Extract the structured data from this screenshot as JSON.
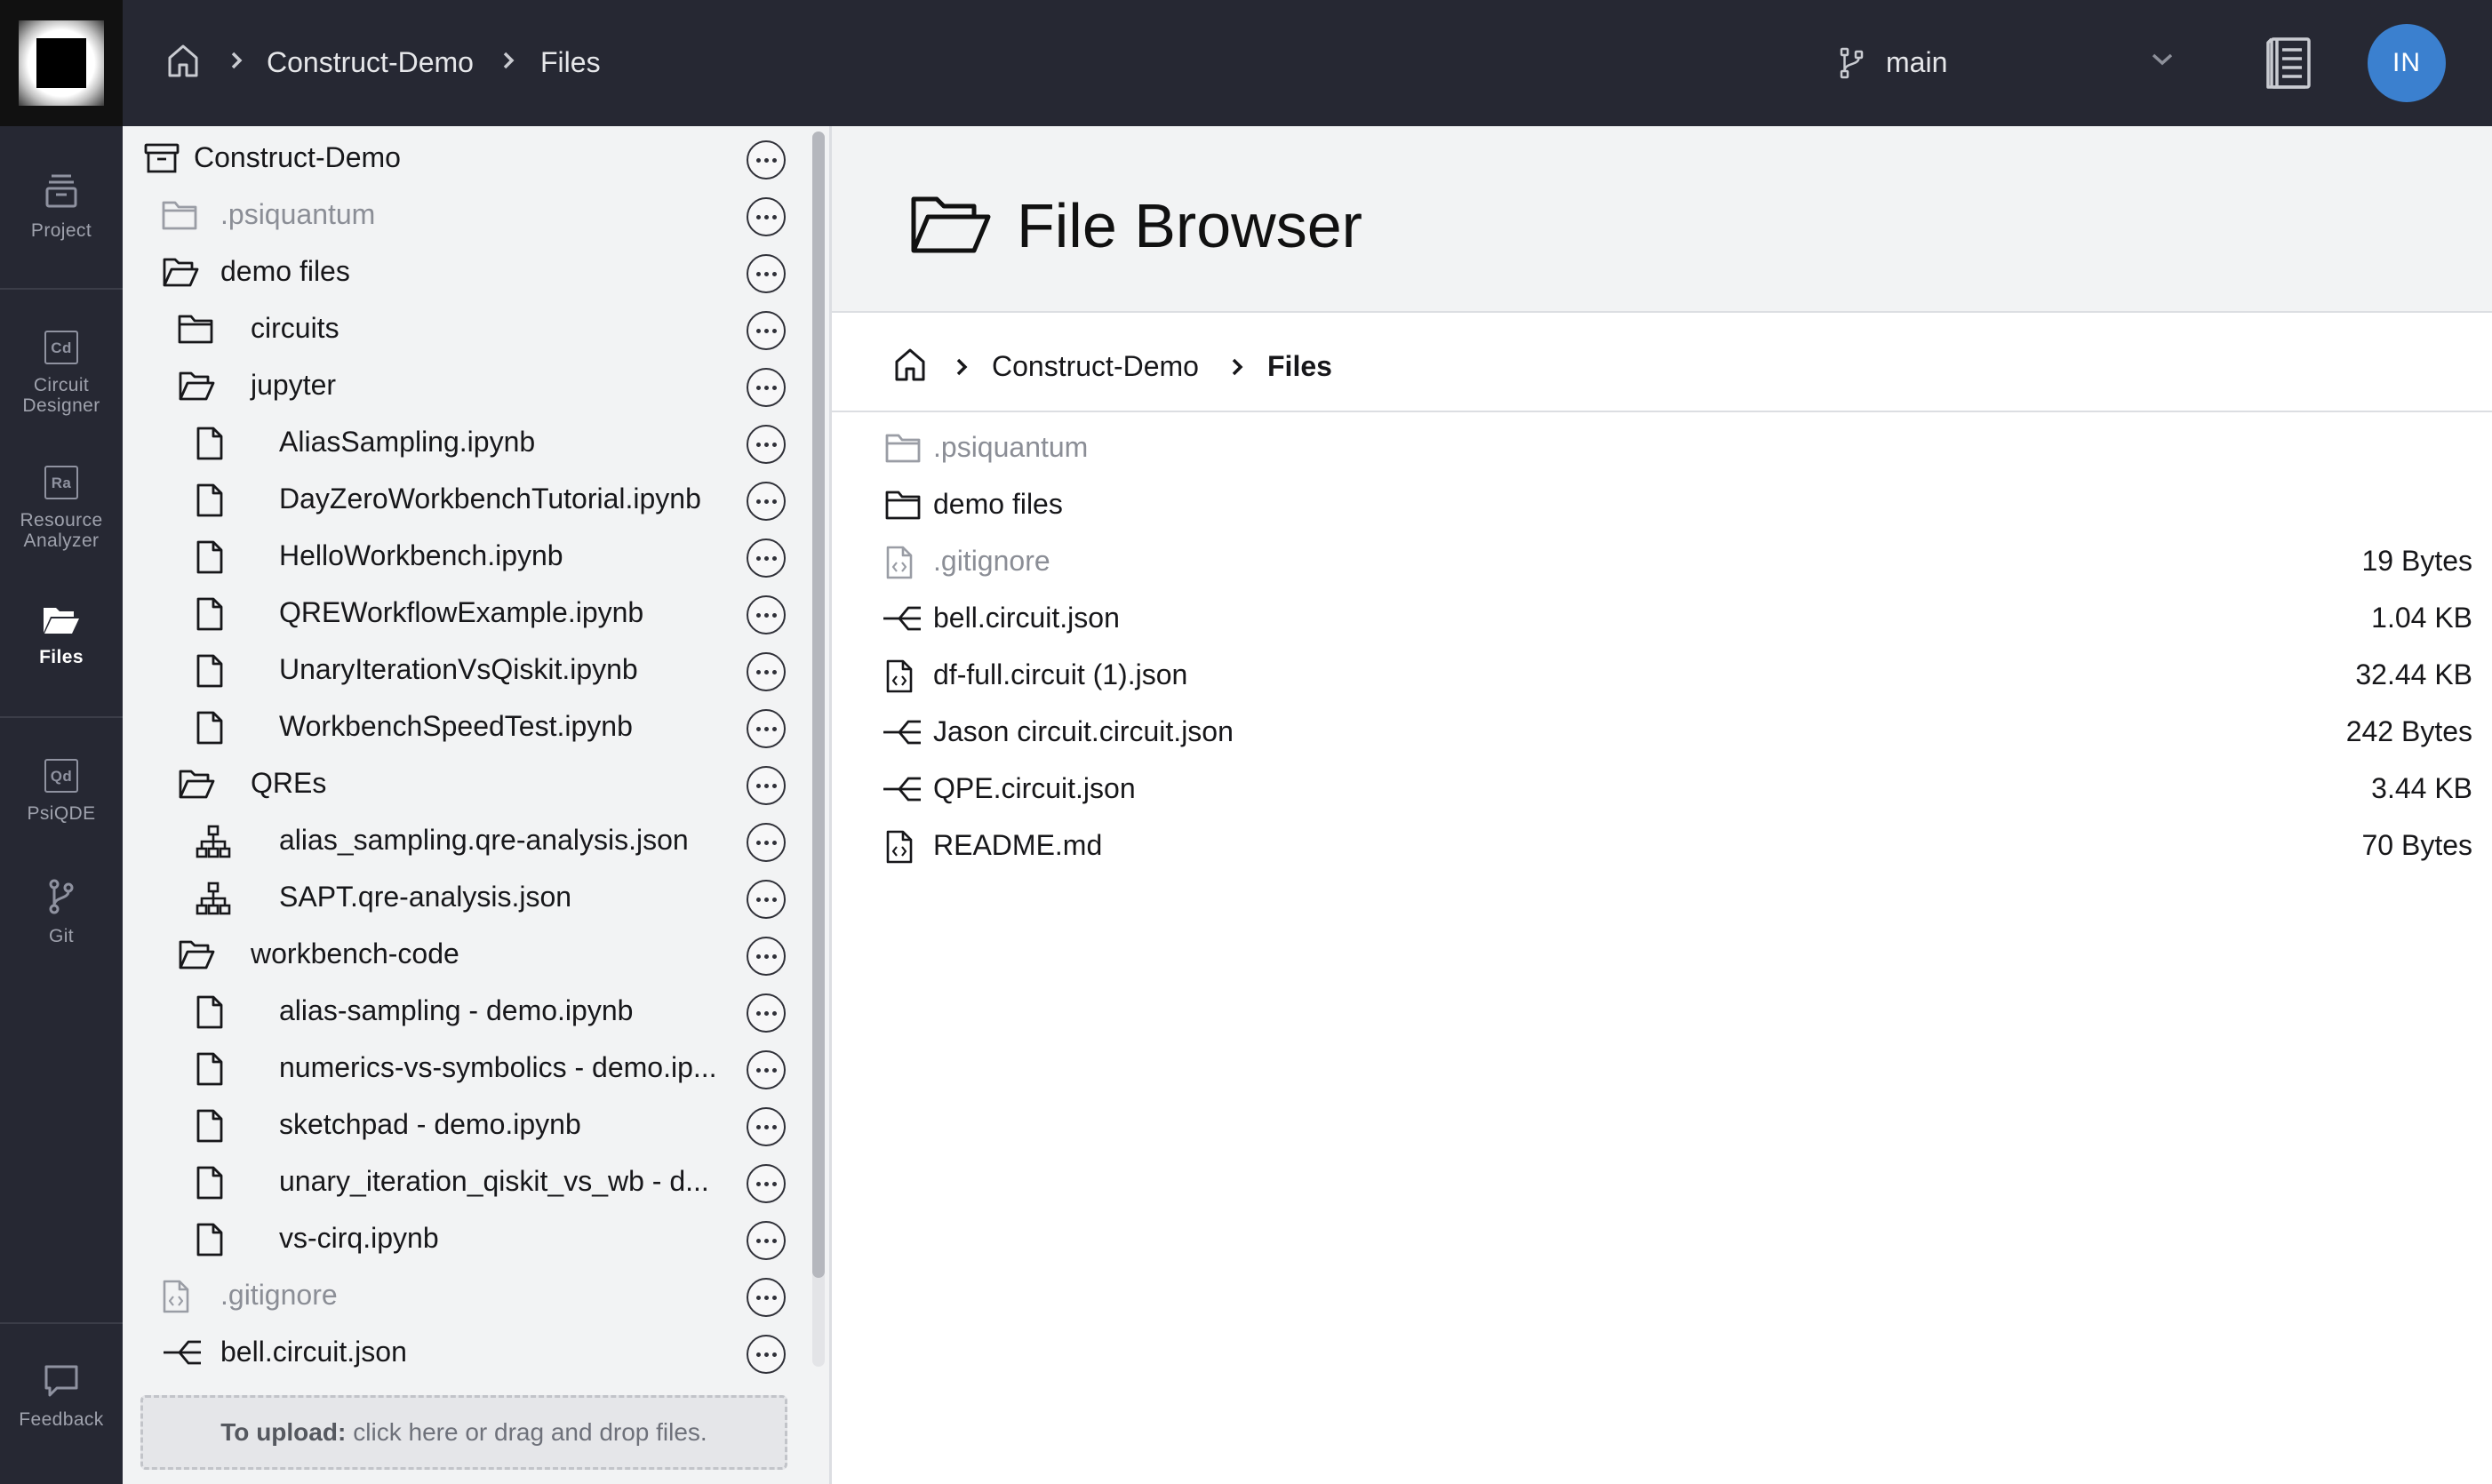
{
  "header": {
    "breadcrumb": [
      "Construct-Demo",
      "Files"
    ],
    "branch": "main",
    "avatar_initials": "IN"
  },
  "rail": {
    "items": [
      {
        "label": "Project",
        "icon": "project-icon"
      },
      {
        "label": "Circuit\nDesigner",
        "icon": "circuit-designer-icon",
        "abbr": "Cd"
      },
      {
        "label": "Resource\nAnalyzer",
        "icon": "resource-analyzer-icon",
        "abbr": "Ra"
      },
      {
        "label": "Files",
        "icon": "folder-open-icon",
        "active": true
      },
      {
        "label": "PsiQDE",
        "icon": "psiqde-icon",
        "abbr": "Qd"
      },
      {
        "label": "Git",
        "icon": "git-branch-icon"
      },
      {
        "label": "Feedback",
        "icon": "feedback-icon"
      }
    ]
  },
  "tree": {
    "items": [
      {
        "label": "Construct-Demo",
        "icon": "repository-icon",
        "depth": 0
      },
      {
        "label": ".psiquantum",
        "icon": "folder-icon",
        "depth": 1,
        "muted": true
      },
      {
        "label": "demo files",
        "icon": "folder-open-icon",
        "depth": 1
      },
      {
        "label": "circuits",
        "icon": "folder-icon",
        "depth": 2
      },
      {
        "label": "jupyter",
        "icon": "folder-open-icon",
        "depth": 2
      },
      {
        "label": "AliasSampling.ipynb",
        "icon": "file-icon",
        "depth": 3
      },
      {
        "label": "DayZeroWorkbenchTutorial.ipynb",
        "icon": "file-icon",
        "depth": 3
      },
      {
        "label": "HelloWorkbench.ipynb",
        "icon": "file-icon",
        "depth": 3
      },
      {
        "label": "QREWorkflowExample.ipynb",
        "icon": "file-icon",
        "depth": 3
      },
      {
        "label": "UnaryIterationVsQiskit.ipynb",
        "icon": "file-icon",
        "depth": 3
      },
      {
        "label": "WorkbenchSpeedTest.ipynb",
        "icon": "file-icon",
        "depth": 3
      },
      {
        "label": "QREs",
        "icon": "folder-open-icon",
        "depth": 2
      },
      {
        "label": "alias_sampling.qre-analysis.json",
        "icon": "hierarchy-icon",
        "depth": 3
      },
      {
        "label": "SAPT.qre-analysis.json",
        "icon": "hierarchy-icon",
        "depth": 3
      },
      {
        "label": "workbench-code",
        "icon": "folder-open-icon",
        "depth": 2
      },
      {
        "label": "alias-sampling - demo.ipynb",
        "icon": "file-icon",
        "depth": 3
      },
      {
        "label": "numerics-vs-symbolics - demo.ip...",
        "icon": "file-icon",
        "depth": 3
      },
      {
        "label": "sketchpad - demo.ipynb",
        "icon": "file-icon",
        "depth": 3
      },
      {
        "label": "unary_iteration_qiskit_vs_wb - d...",
        "icon": "file-icon",
        "depth": 3
      },
      {
        "label": "vs-cirq.ipynb",
        "icon": "file-icon",
        "depth": 3
      },
      {
        "label": ".gitignore",
        "icon": "code-file-icon",
        "depth": 1,
        "muted": true
      },
      {
        "label": "bell.circuit.json",
        "icon": "circuit-icon",
        "depth": 1
      }
    ],
    "upload_bold": "To upload:",
    "upload_text": "click here or drag and drop files."
  },
  "main": {
    "title": "File Browser",
    "breadcrumb": [
      "Construct-Demo",
      "Files"
    ],
    "files": [
      {
        "name": ".psiquantum",
        "icon": "folder-icon",
        "size": "",
        "muted": true
      },
      {
        "name": "demo files",
        "icon": "folder-icon",
        "size": ""
      },
      {
        "name": ".gitignore",
        "icon": "code-file-icon",
        "size": "19 Bytes",
        "muted": true
      },
      {
        "name": "bell.circuit.json",
        "icon": "circuit-icon",
        "size": "1.04 KB"
      },
      {
        "name": "df-full.circuit (1).json",
        "icon": "code-file-icon",
        "size": "32.44 KB"
      },
      {
        "name": "Jason circuit.circuit.json",
        "icon": "circuit-icon",
        "size": "242 Bytes"
      },
      {
        "name": "QPE.circuit.json",
        "icon": "circuit-icon",
        "size": "3.44 KB"
      },
      {
        "name": "README.md",
        "icon": "code-file-icon",
        "size": "70 Bytes"
      }
    ]
  }
}
